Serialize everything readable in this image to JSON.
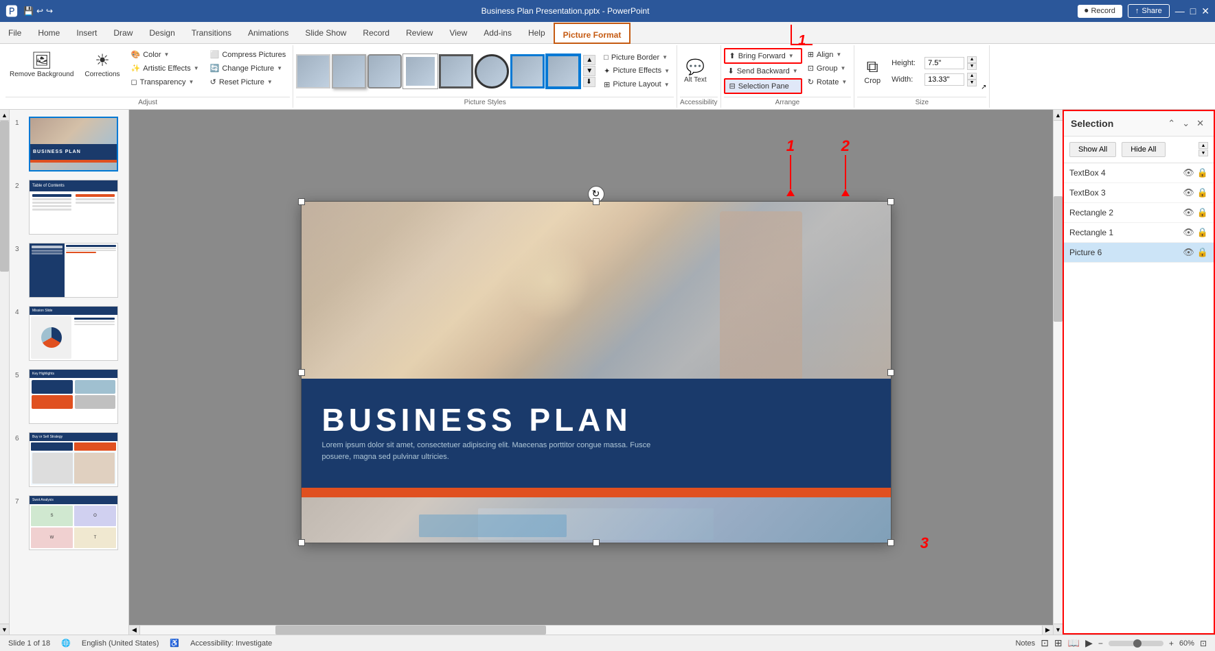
{
  "titlebar": {
    "app": "PowerPoint",
    "filename": "Business Plan Presentation.pptx - PowerPoint",
    "record_label": "Record",
    "share_label": "Share"
  },
  "tabs": [
    {
      "id": "file",
      "label": "File"
    },
    {
      "id": "home",
      "label": "Home"
    },
    {
      "id": "insert",
      "label": "Insert"
    },
    {
      "id": "draw",
      "label": "Draw"
    },
    {
      "id": "design",
      "label": "Design"
    },
    {
      "id": "transitions",
      "label": "Transitions"
    },
    {
      "id": "animations",
      "label": "Animations"
    },
    {
      "id": "slideshow",
      "label": "Slide Show"
    },
    {
      "id": "record",
      "label": "Record"
    },
    {
      "id": "review",
      "label": "Review"
    },
    {
      "id": "view",
      "label": "View"
    },
    {
      "id": "addins",
      "label": "Add-ins"
    },
    {
      "id": "help",
      "label": "Help"
    },
    {
      "id": "pictureformat",
      "label": "Picture Format",
      "active": true
    }
  ],
  "ribbon": {
    "groups": {
      "adjust": {
        "title": "Adjust",
        "remove_bg": "Remove Background",
        "corrections": "Corrections",
        "color": "Color",
        "artistic_effects": "Artistic Effects",
        "transparency": "Transparency",
        "compress_pictures": "Compress Pictures",
        "change_picture": "Change Picture",
        "reset_picture": "Reset Picture"
      },
      "picture_styles": {
        "title": "Picture Styles"
      },
      "accessibility": {
        "title": "Accessibility",
        "alt_text": "Alt Text"
      },
      "arrange": {
        "title": "Arrange",
        "bring_forward": "Bring Forward",
        "send_backward": "Send Backward",
        "selection_pane": "Selection Pane",
        "align": "Align",
        "group": "Group",
        "rotate": "Rotate"
      },
      "size": {
        "title": "Size",
        "crop": "Crop",
        "height_label": "Height:",
        "height_val": "7.5\"",
        "width_label": "Width:",
        "width_val": "13.33\""
      },
      "picture_border": {
        "label": "Picture Border"
      },
      "picture_effects": {
        "label": "Picture Effects"
      },
      "picture_layout": {
        "label": "Picture Layout"
      }
    }
  },
  "selection_pane": {
    "title": "Selection",
    "show_all": "Show All",
    "hide_all": "Hide All",
    "items": [
      {
        "id": "textbox4",
        "label": "TextBox 4",
        "selected": false
      },
      {
        "id": "textbox3",
        "label": "TextBox 3",
        "selected": false
      },
      {
        "id": "rectangle2",
        "label": "Rectangle 2",
        "selected": false
      },
      {
        "id": "rectangle1",
        "label": "Rectangle 1",
        "selected": false
      },
      {
        "id": "picture6",
        "label": "Picture 6",
        "selected": true
      }
    ]
  },
  "size_panel": {
    "height_label": "Height:",
    "height_value": "7.5\"",
    "width_label": "Width:",
    "width_value": "13.33\""
  },
  "slides": [
    {
      "num": 1,
      "active": true
    },
    {
      "num": 2,
      "active": false
    },
    {
      "num": 3,
      "active": false
    },
    {
      "num": 4,
      "active": false
    },
    {
      "num": 5,
      "active": false
    },
    {
      "num": 6,
      "active": false
    },
    {
      "num": 7,
      "active": false
    }
  ],
  "slide_content": {
    "title": "BUSINESS PLAN",
    "body": "Lorem ipsum dolor sit amet, consectetuer adipiscing elit. Maecenas porttitor congue massa. Fusce posuere, magna sed pulvinar ultricies."
  },
  "statusbar": {
    "slide_info": "Slide 1 of 18",
    "language": "English (United States)",
    "accessibility": "Accessibility: Investigate",
    "notes": "Notes"
  },
  "annotations": {
    "num1": "1",
    "num2": "2",
    "num3": "3"
  }
}
